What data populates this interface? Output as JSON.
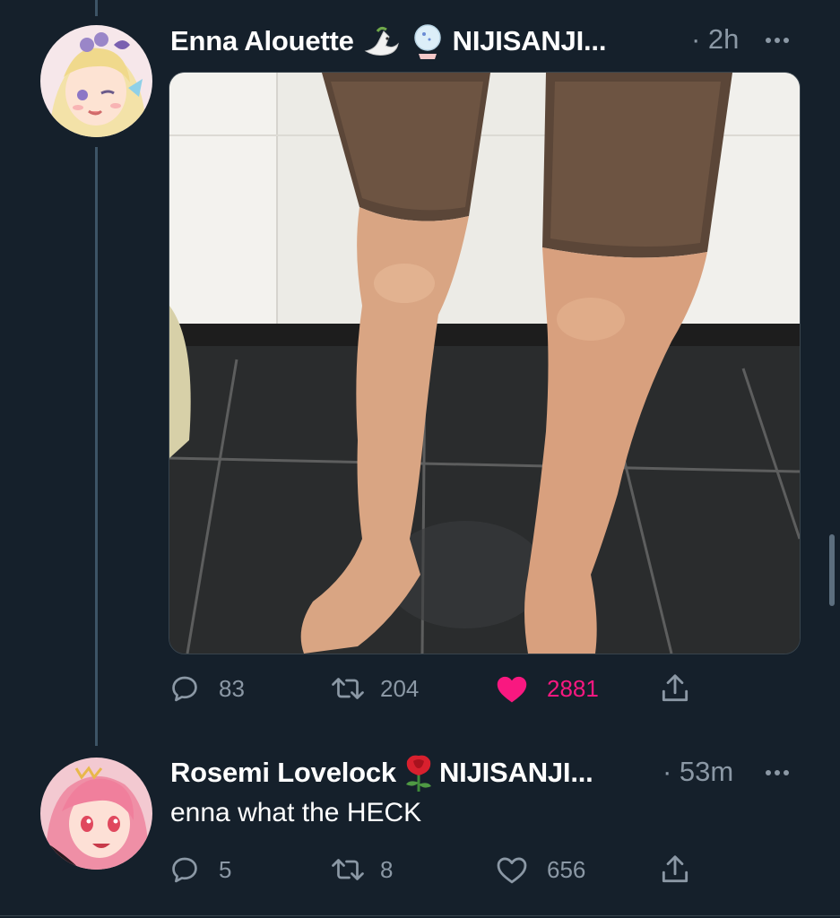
{
  "tweets": [
    {
      "author": "Enna Alouette",
      "badge": "NIJISANJI...",
      "time": "· 2h",
      "text": "",
      "stats": {
        "replies": "83",
        "retweets": "204",
        "likes": "2881"
      },
      "liked": true,
      "icons": [
        "dove-emoji",
        "glass-globe-emoji"
      ]
    },
    {
      "author": "Rosemi Lovelock",
      "badge": "NIJISANJI...",
      "time": "· 53m",
      "text": "enna what the HECK",
      "stats": {
        "replies": "5",
        "retweets": "8",
        "likes": "656"
      },
      "liked": false,
      "icons": [
        "rose-emoji"
      ]
    }
  ],
  "colors": {
    "background": "#15202b",
    "muted": "#8b98a5",
    "like": "#f91880",
    "thread_line": "#3d5466"
  }
}
